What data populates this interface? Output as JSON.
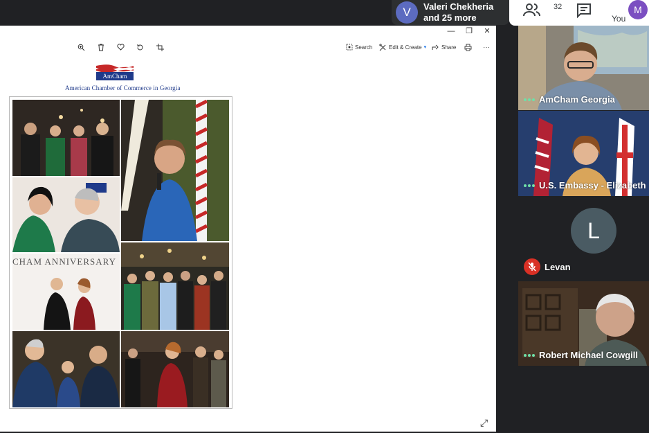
{
  "meet": {
    "active_speaker": {
      "initial": "V",
      "line1": "Valeri Chekheria",
      "line2": "and 25 more"
    },
    "people_count": "32",
    "self": {
      "initial": "M",
      "label": "You"
    }
  },
  "photos_window": {
    "toolbar": {
      "search_label": "Search",
      "edit_label": "Edit & Create",
      "share_label": "Share"
    },
    "document": {
      "logo_text": "AmCham",
      "org_name": "American Chamber of Commerce in Georgia",
      "banner_text": "CHAM ANNIVERSARY"
    }
  },
  "participants": [
    {
      "name": "AmCham Georgia",
      "muted": false
    },
    {
      "name": "U.S. Embassy - Elizabeth",
      "muted": false
    },
    {
      "name": "Levan",
      "initial": "L",
      "muted": true
    },
    {
      "name": "Robert Michael Cowgill",
      "muted": false
    }
  ],
  "colors": {
    "meet_bg": "#202124",
    "speaker_avatar": "#5c6bc0",
    "self_avatar": "#7b4fc1",
    "mute_red": "#d93025",
    "talk_green": "#6fe0a8",
    "amcham_blue": "#1f3a8a",
    "amcham_red": "#c62828"
  }
}
